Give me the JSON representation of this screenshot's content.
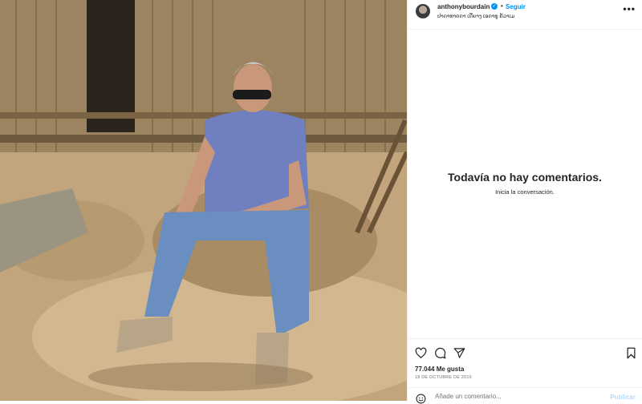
{
  "post": {
    "username": "anthonybourdain",
    "verified_mark": "✓",
    "separator": "•",
    "follow_label": "Seguir",
    "location": "ປາດາທາດດາ ເດີຍາງ ເອດາທູ ຄ້ວາເມ",
    "more_label": "•••",
    "image_alt": "photo-man-sitting-bamboo-hut"
  },
  "comments": {
    "empty_title": "Todavía no hay comentarios.",
    "empty_subtitle": "Inicia la conversación."
  },
  "actions": {
    "icons": [
      "heart-icon",
      "comment-icon",
      "share-icon",
      "bookmark-icon"
    ]
  },
  "stats": {
    "likes": "77.044 Me gusta",
    "date": "18 DE OCTUBRE DE 2016"
  },
  "compose": {
    "placeholder": "Añade un comentario...",
    "publish_label": "Publicar"
  },
  "colors": {
    "accent": "#0095f6",
    "publish_disabled": "#b3dbff",
    "text": "#262626",
    "secondary": "#737373"
  }
}
